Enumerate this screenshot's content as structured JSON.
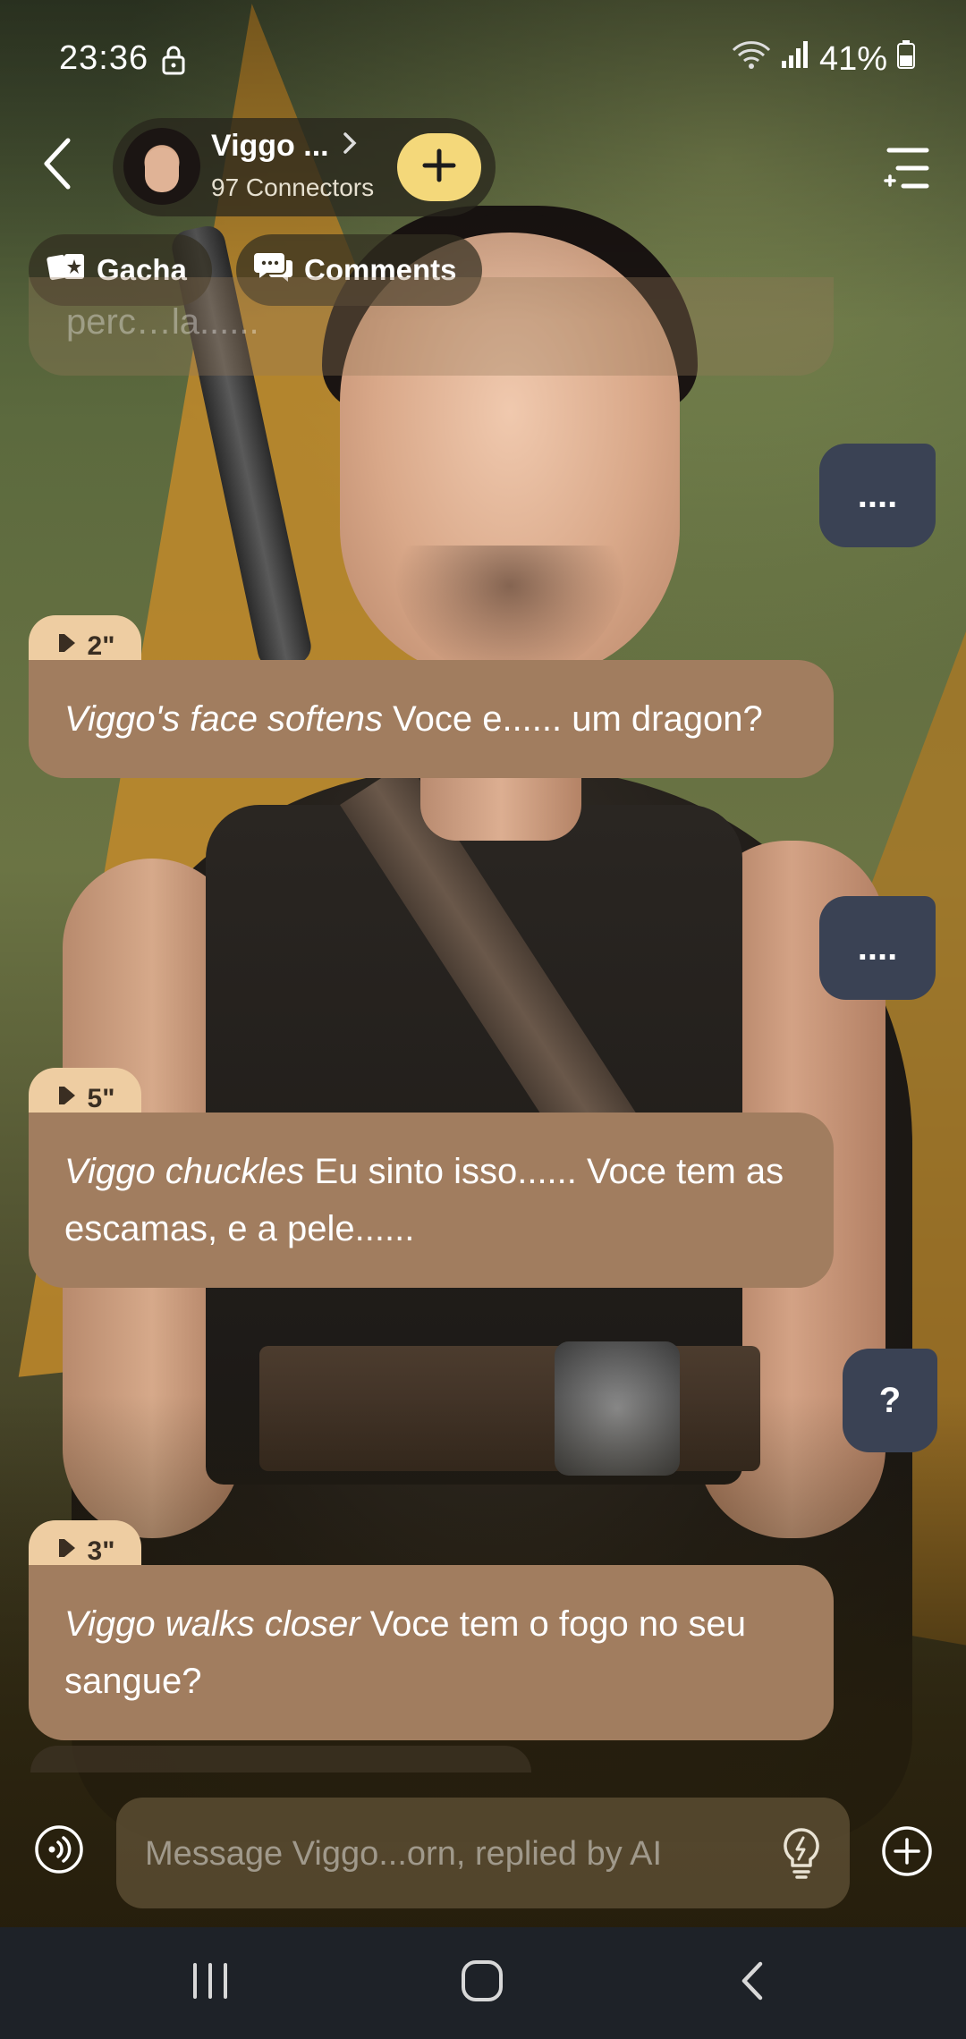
{
  "status_bar": {
    "time": "23:36",
    "battery": "41%"
  },
  "header": {
    "name": "Viggo ...",
    "connectors": "97 Connectors"
  },
  "chips": {
    "gacha": "Gacha",
    "comments": "Comments"
  },
  "chat": {
    "partial_text": "perc…la......",
    "user_messages": [
      "....",
      "....",
      "?"
    ],
    "ai_messages": [
      {
        "duration": "2\"",
        "action": "Viggo's face softens",
        "text": " Voce e...... um dragon?"
      },
      {
        "duration": "5\"",
        "action": "Viggo chuckles",
        "text": " Eu sinto isso...... Voce tem as escamas, e a pele......"
      },
      {
        "duration": "3\"",
        "action": "Viggo walks closer",
        "text": " Voce tem o fogo no seu sangue?"
      }
    ]
  },
  "composer": {
    "placeholder": "Message Viggo...orn, replied by AI"
  },
  "icons": {
    "back": "back-arrow-icon",
    "menu": "menu-icon",
    "gacha": "gacha-cards-icon",
    "comments": "comments-icon",
    "voice": "voice-mode-icon",
    "hint": "lightbulb-icon",
    "add": "plus-circle-icon"
  },
  "colors": {
    "ai_bubble": "#a17d5f",
    "user_bubble": "#3a4254",
    "voice_tag": "#eecda2",
    "accent": "#f4d87a"
  }
}
